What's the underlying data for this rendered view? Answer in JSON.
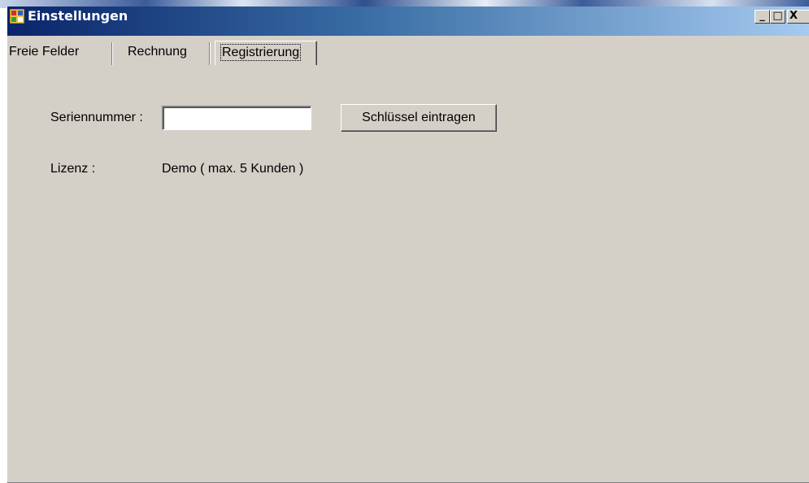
{
  "window": {
    "title": "Einstellungen",
    "controls": {
      "minimize": "_",
      "maximize": "□",
      "close": "X"
    }
  },
  "tabs": [
    {
      "label": "Freie Felder",
      "selected": false
    },
    {
      "label": "Rechnung",
      "selected": false
    },
    {
      "label": "Registrierung",
      "selected": true
    }
  ],
  "registration": {
    "serial_label": "Seriennummer :",
    "serial_value": "",
    "submit_label": "Schlüssel eintragen",
    "license_label": "Lizenz :",
    "license_value": "Demo ( max. 5 Kunden )"
  }
}
